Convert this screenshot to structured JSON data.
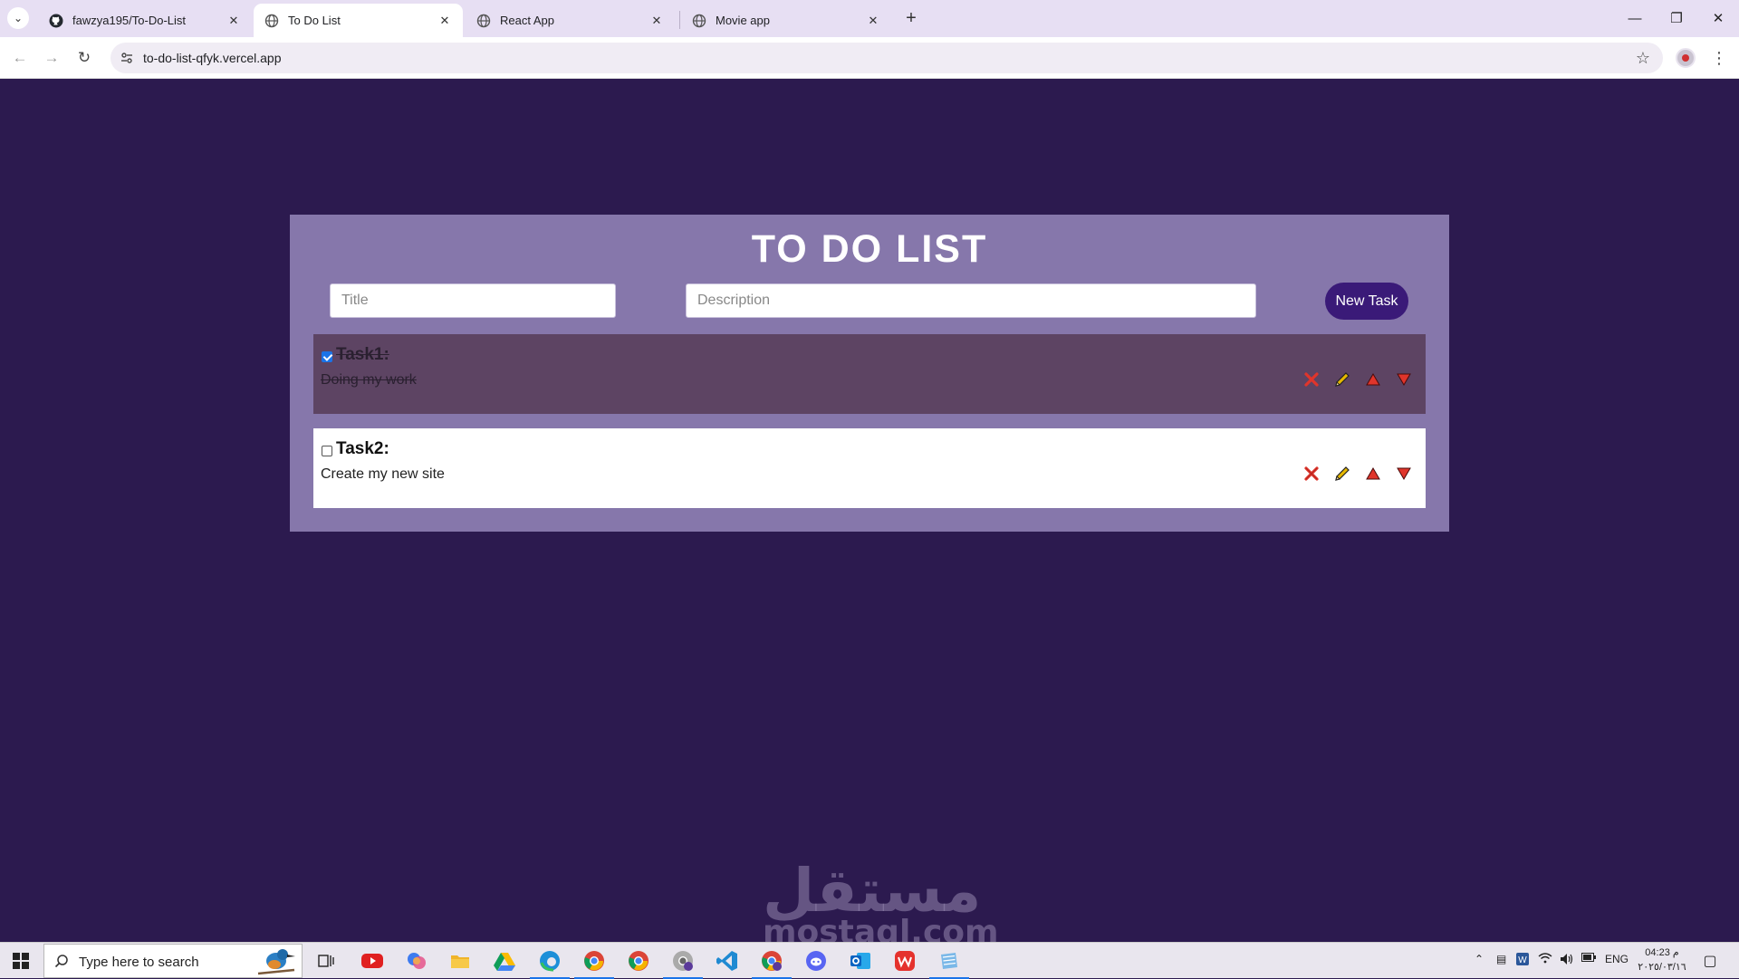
{
  "browser": {
    "tabs": [
      {
        "title": "fawzya195/To-Do-List",
        "icon": "github-icon",
        "active": false
      },
      {
        "title": "To Do List",
        "icon": "globe-icon",
        "active": true
      },
      {
        "title": "React App",
        "icon": "globe-icon",
        "active": false
      },
      {
        "title": "Movie app",
        "icon": "globe-icon",
        "active": false
      }
    ],
    "url": "to-do-list-qfyk.vercel.app"
  },
  "app": {
    "title": "TO DO LIST",
    "title_placeholder": "Title",
    "description_placeholder": "Description",
    "new_task_label": "New Task",
    "tasks": [
      {
        "title": "Task1:",
        "description": "Doing my work",
        "completed": true
      },
      {
        "title": "Task2:",
        "description": "Create my new site",
        "completed": false
      }
    ],
    "colors": {
      "page_background": "#2c1a4f",
      "card_background": "#8677ab",
      "completed_task_background": "#5d4463",
      "button_background": "#3a1a78",
      "action_red": "#e0352b",
      "edit_pencil": "#e6b800"
    }
  },
  "watermark": {
    "text_ar": "مستقل",
    "text_latin": "mostaql.com"
  },
  "taskbar": {
    "search_placeholder": "Type here to search",
    "apps": [
      "task-view-icon",
      "youtube-icon",
      "copilot-icon",
      "file-explorer-icon",
      "google-drive-icon",
      "edge-icon",
      "chrome-icon",
      "chrome-icon",
      "chrome-icon",
      "vscode-icon",
      "chrome-icon",
      "discord-icon",
      "outlook-icon",
      "wps-icon",
      "notepad-icon"
    ],
    "language": "ENG",
    "time": "04:23 م",
    "date": "٢٠٢٥/٠٣/١٦"
  }
}
